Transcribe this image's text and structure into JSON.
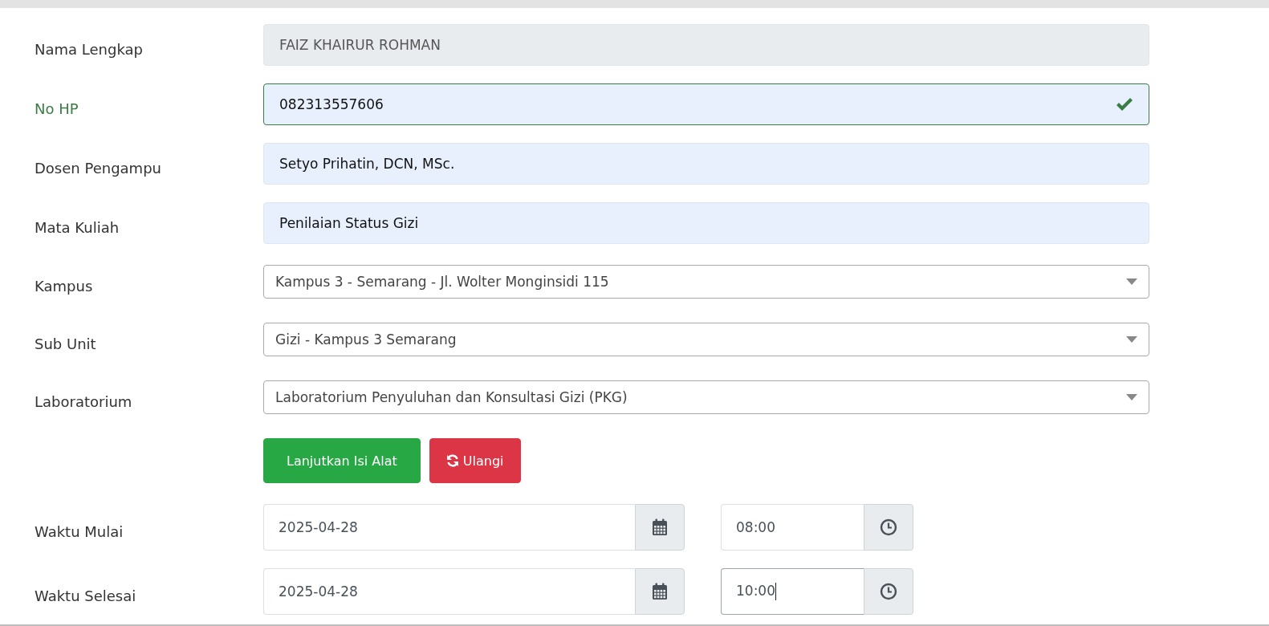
{
  "fields": [
    {
      "label": "Nama Lengkap",
      "kind": "readonly",
      "value": "FAIZ KHAIRUR ROHMAN"
    },
    {
      "label": "No HP",
      "kind": "valid",
      "value": "082313557606"
    },
    {
      "label": "Dosen Pengampu",
      "kind": "filled",
      "value": "Setyo Prihatin, DCN, MSc."
    },
    {
      "label": "Mata Kuliah",
      "kind": "filled",
      "value": "Penilaian Status Gizi"
    },
    {
      "label": "Kampus",
      "kind": "select",
      "value": "Kampus 3 - Semarang - Jl. Wolter Monginsidi 115"
    },
    {
      "label": "Sub Unit",
      "kind": "select",
      "value": "Gizi - Kampus 3 Semarang"
    },
    {
      "label": "Laboratorium",
      "kind": "select",
      "value": "Laboratorium Penyuluhan dan Konsultasi Gizi (PKG)"
    }
  ],
  "buttons": [
    {
      "label": "Lanjutkan Isi Alat",
      "kind": "primary"
    },
    {
      "label": "Ulangi",
      "kind": "reset"
    }
  ],
  "schedule": [
    {
      "label": "Waktu Mulai",
      "date": "2025-04-28",
      "time": "08:00",
      "time_focused": false
    },
    {
      "label": "Waktu Selesai",
      "date": "2025-04-28",
      "time": "10:00",
      "time_focused": true
    }
  ]
}
